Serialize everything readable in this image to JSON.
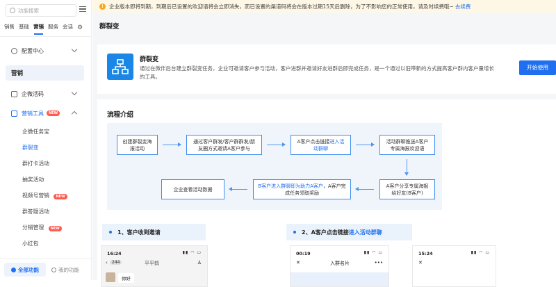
{
  "sidebar": {
    "search_placeholder": "功能搜索",
    "tabs": [
      "销售",
      "基础",
      "营销",
      "服务",
      "会话"
    ],
    "config_center": "配置中心",
    "marketing": "营销",
    "wechat_code": "企微活码",
    "marketing_tools": "营销工具",
    "new_badge": "NEW",
    "sub_items": [
      "企微任务宝",
      "群裂变",
      "群打卡活动",
      "抽奖活动",
      "视频号营销",
      "群答题活动",
      "分销管理",
      "小红包",
      "…"
    ],
    "all_functions": "全部功能",
    "my_functions": "我的功能"
  },
  "notice": {
    "text": "企业版本即将到期，到期后已设置的欢迎语将会立即消失，而已设置的渠道码将会在版本过期15天后删除，为了不影响您的正常使用，请及时续费哦~",
    "link": "去续费"
  },
  "page": {
    "title": "群裂变",
    "hero_title": "群裂变",
    "hero_desc": "通过在微伴后台建立群裂变任务，企业可邀请客户参与活动，客户进群并邀请好友进群后即完成任务，是一个通过以旧带新的方式提高客户群内客户量增长的工具。",
    "start_button": "开始使用"
  },
  "flow": {
    "title": "流程介绍",
    "step1": "创建群裂变海报活动",
    "step2": "通过客户群发/客户群群发/朋友圈方式邀请A客户参与",
    "step3_a": "A客户点击链接",
    "step3_b": "进入活动群聊",
    "step4": "活动群聊推送A客户专属海报欢迎语",
    "step5": "A客户分享专属海报给好友(B客户)",
    "step6_a": "B客户进入群聊即为助力A客户",
    "step6_b": "，A客户完成任务领取奖励",
    "step7": "企业查看活动数据"
  },
  "steps_preview": {
    "s1": "1、客户收到邀请",
    "s2_a": "2、A客户点击链接",
    "s2_b": "进入活动群聊",
    "phone1_time": "16:24",
    "phone1_back": "244",
    "phone1_name": "平平鹤",
    "phone1_msg": "你好",
    "phone2_time": "00:19",
    "phone2_title": "入群名片",
    "phone3_time": "15:24"
  }
}
